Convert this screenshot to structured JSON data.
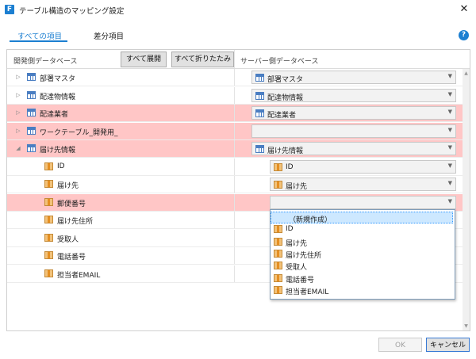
{
  "window": {
    "title": "テーブル構造のマッピング設定",
    "app_icon_letter": "F"
  },
  "tabs": [
    {
      "label": "すべての項目",
      "active": true
    },
    {
      "label": "差分項目",
      "active": false
    }
  ],
  "header": {
    "left_label": "開発側データベース",
    "expand_all": "すべて展開",
    "collapse_all": "すべて折りたたみ",
    "right_label": "サーバー側データベース"
  },
  "rows": [
    {
      "label": "部署マスタ",
      "type": "table",
      "expander": "collapsed",
      "highlight": false,
      "mapped": "部署マスタ"
    },
    {
      "label": "配達物情報",
      "type": "table",
      "expander": "collapsed",
      "highlight": false,
      "mapped": "配達物情報"
    },
    {
      "label": "配達業者",
      "type": "table",
      "expander": "collapsed",
      "highlight": true,
      "mapped": "配達業者"
    },
    {
      "label": "ワークテーブル_開発用_",
      "type": "table",
      "expander": "collapsed",
      "highlight": true,
      "mapped": ""
    },
    {
      "label": "届け先情報",
      "type": "table",
      "expander": "expanded",
      "highlight": true,
      "mapped": "届け先情報"
    },
    {
      "label": "ID",
      "type": "column",
      "highlight": false,
      "mapped": "ID"
    },
    {
      "label": "届け先",
      "type": "column",
      "highlight": false,
      "mapped": "届け先"
    },
    {
      "label": "郵便番号",
      "type": "column",
      "highlight": true,
      "mapped": ""
    },
    {
      "label": "届け先住所",
      "type": "column",
      "highlight": false,
      "mapped": null
    },
    {
      "label": "受取人",
      "type": "column",
      "highlight": false,
      "mapped": null
    },
    {
      "label": "電話番号",
      "type": "column",
      "highlight": false,
      "mapped": null
    },
    {
      "label": "担当者EMAIL",
      "type": "column",
      "highlight": false,
      "mapped": null
    }
  ],
  "dropdown_popup": {
    "items": [
      {
        "label": "（新規作成）",
        "selected": true,
        "icon": false
      },
      {
        "label": "ID",
        "selected": false,
        "icon": true
      },
      {
        "label": "届け先",
        "selected": false,
        "icon": true
      },
      {
        "label": "届け先住所",
        "selected": false,
        "icon": true
      },
      {
        "label": "受取人",
        "selected": false,
        "icon": true
      },
      {
        "label": "電話番号",
        "selected": false,
        "icon": true
      },
      {
        "label": "担当者EMAIL",
        "selected": false,
        "icon": true
      }
    ]
  },
  "footer": {
    "ok": "OK",
    "cancel": "キャンセル"
  },
  "colors": {
    "accent": "#1c7fd1",
    "highlight_row": "#ffc6c6"
  }
}
